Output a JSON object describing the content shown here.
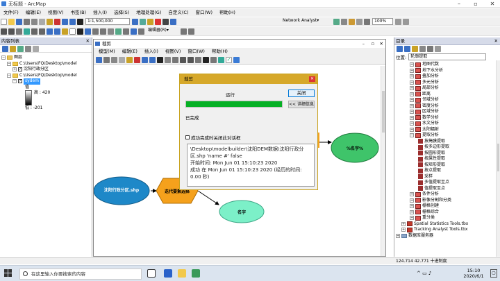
{
  "window": {
    "title": "无标题 - ArcMap"
  },
  "menu": [
    "文件(F)",
    "编辑(E)",
    "视图(V)",
    "书签(B)",
    "插入(I)",
    "选择(S)",
    "地理处理(G)",
    "自定义(C)",
    "窗口(W)",
    "帮助(H)"
  ],
  "toolbar": {
    "scale": "1:1,500,000",
    "network_analyst": "Network Analyst▾",
    "zoom": "100%",
    "editor": "编辑器(R)▾"
  },
  "toc": {
    "title": "内容列表",
    "layers_label": "图层",
    "items": [
      {
        "label": "C:\\Users\\FQ\\Desktop\\model",
        "checked": false
      },
      {
        "label": "沈阳行政分区",
        "checked": true
      },
      {
        "label": "C:\\Users\\FQ\\Desktop\\model",
        "checked": false
      },
      {
        "label": "sydem",
        "checked": true
      }
    ],
    "legend_value_label": "值",
    "legend_high": "高 : 420",
    "legend_low": "低 : -201"
  },
  "catalog": {
    "title": "目录",
    "location_label": "位置:",
    "location_value": "轮廓提取",
    "items": [
      {
        "label": "地图代数",
        "type": "toolset",
        "indent": 1
      },
      {
        "label": "地下水分析",
        "type": "toolset",
        "indent": 1
      },
      {
        "label": "叠加分析",
        "type": "toolset",
        "indent": 1
      },
      {
        "label": "多元分析",
        "type": "toolset",
        "indent": 1
      },
      {
        "label": "局部分析",
        "type": "toolset",
        "indent": 1
      },
      {
        "label": "距离",
        "type": "toolset",
        "indent": 1
      },
      {
        "label": "邻域分析",
        "type": "toolset",
        "indent": 1
      },
      {
        "label": "密度分析",
        "type": "toolset",
        "indent": 1
      },
      {
        "label": "区域分析",
        "type": "toolset",
        "indent": 1
      },
      {
        "label": "数学分析",
        "type": "toolset",
        "indent": 1
      },
      {
        "label": "水文分析",
        "type": "toolset",
        "indent": 1
      },
      {
        "label": "太阳辐射",
        "type": "toolset",
        "indent": 1
      },
      {
        "label": "提取分析",
        "type": "toolset-open",
        "indent": 1
      },
      {
        "label": "按掩膜提取",
        "type": "tool",
        "indent": 2
      },
      {
        "label": "按多边形提取",
        "type": "tool",
        "indent": 2
      },
      {
        "label": "按圆形提取",
        "type": "tool",
        "indent": 2
      },
      {
        "label": "按属性提取",
        "type": "tool",
        "indent": 2
      },
      {
        "label": "按矩形提取",
        "type": "tool",
        "indent": 2
      },
      {
        "label": "按点提取",
        "type": "tool",
        "indent": 2
      },
      {
        "label": "采样",
        "type": "tool",
        "indent": 2
      },
      {
        "label": "多值提取至点",
        "type": "tool",
        "indent": 2
      },
      {
        "label": "值提取至点",
        "type": "tool",
        "indent": 2
      },
      {
        "label": "条件分析",
        "type": "toolset",
        "indent": 1
      },
      {
        "label": "影像分割和分类",
        "type": "toolset",
        "indent": 1
      },
      {
        "label": "栅格创建",
        "type": "toolset",
        "indent": 1
      },
      {
        "label": "栅格综合",
        "type": "toolset",
        "indent": 1
      },
      {
        "label": "重分类",
        "type": "toolset",
        "indent": 1
      },
      {
        "label": "Spatial Statistics Tools.tbx",
        "type": "toolbox",
        "indent": 0
      },
      {
        "label": "Tracking Analyst Tools.tbx",
        "type": "toolbox",
        "indent": 0
      },
      {
        "label": "数据库服务器",
        "type": "server",
        "indent": -1
      }
    ]
  },
  "modelbuilder": {
    "title": "裁剪",
    "menu": [
      "模型(M)",
      "编辑(E)",
      "插入(I)",
      "视图(V)",
      "窗口(W)",
      "帮助(H)"
    ],
    "nodes": {
      "input": "沈阳行政分区.shp",
      "iterator": "迭代要素选择",
      "value": "名字",
      "output": "%名字%"
    }
  },
  "dialog": {
    "title": "裁剪",
    "status": "运行",
    "close_button": "关闭",
    "details_button": "<< 详细信息",
    "progress": 1.0,
    "completed": "已完成",
    "checkbox_label": "成功完成时关闭此对话框",
    "log": [
      "\\Desktop\\modelbuilder\\沈阳DEM数据\\沈阳行政分区.shp 'name #' false",
      "开始时间: Mon Jun 01 15:10:23 2020",
      "成功 在 Mon Jun 01 15:10:23 2020 (经历的时间: 0.00 秒)"
    ]
  },
  "status_bar": {
    "coords": "124.714  42.771 十进制度"
  },
  "taskbar": {
    "search_placeholder": "在这里输入你要搜索的内容",
    "time": "15:10",
    "date": "2020/6/1"
  },
  "colors": {
    "progress": "#06b025",
    "dialog_title": "#d6a82a",
    "input_node": "#1e88c8",
    "iterator_node": "#f5a11c",
    "output_node": "#3fc46a",
    "value_node": "#7cf0c8"
  }
}
